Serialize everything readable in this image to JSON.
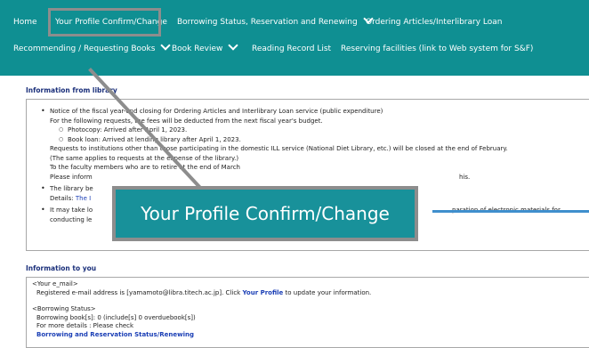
{
  "nav": {
    "row1": [
      {
        "label": "Home"
      },
      {
        "label": "Your Profile Confirm/Change"
      },
      {
        "label": "Borrowing Status, Reservation and Renewing"
      },
      {
        "label": "Ordering Articles/Interlibrary Loan"
      }
    ],
    "row2": [
      {
        "label": "Recommending / Requesting Books"
      },
      {
        "label": "Book Review"
      },
      {
        "label": "Reading Record List"
      },
      {
        "label": "Reserving facilities (link to Web system for S&F)"
      }
    ]
  },
  "library_info": {
    "title": "Information from library",
    "b1_line1": "Notice of the fiscal year-end closing for Ordering Articles and Interlibrary Loan service (public expenditure)",
    "b1_line2": "For the following requests, the fees will be deducted from the next fiscal year's budget.",
    "b1_sub1": "Photocopy:   Arrived after April 1, 2023.",
    "b1_sub2": "Book loan:   Arrived at lending library after April 1, 2023.",
    "b1_line3": "Requests to institutions other than those participating in the domestic ILL service (National Diet Library, etc.) will be closed at the end of February.",
    "b1_line4": "(The same applies to requests at the expense of the library.)",
    "b1_line5": "To the faculty members who are to retire at the end of March",
    "b1_line6_a": "Please inform",
    "b1_line6_b": "his.",
    "b2_line1": "The library be",
    "b2_line2_label": "Details:",
    "b2_line2_link": "The I",
    "b3_line1_a": "It may take lo",
    "b3_line1_b": "paration of electronic materials for",
    "b3_line2": "conducting le"
  },
  "user_info": {
    "title": "Information to you",
    "email_heading": "<Your e_mail>",
    "email_text": "Registered e-mail address is [yamamoto@libra.titech.ac.jp]. Click",
    "email_link": "Your Profile",
    "email_after": "to update your information.",
    "borrow_heading": "<Borrowing Status>",
    "borrow_line1": "Borrowing book[s]: 0 (include[s] 0 overduebook[s])",
    "borrow_line2": "For more details : Please check",
    "borrow_link": "Borrowing and Reservation Status/Renewing"
  },
  "callout": {
    "label": "Your Profile Confirm/Change"
  },
  "colors": {
    "nav_bg": "#0f8f92",
    "callout_bg": "#18919a",
    "link": "#1a3eb5",
    "title": "#1a2f7a",
    "highlight_border": "#8d8d8d",
    "accent_line": "#3f8fcd"
  }
}
